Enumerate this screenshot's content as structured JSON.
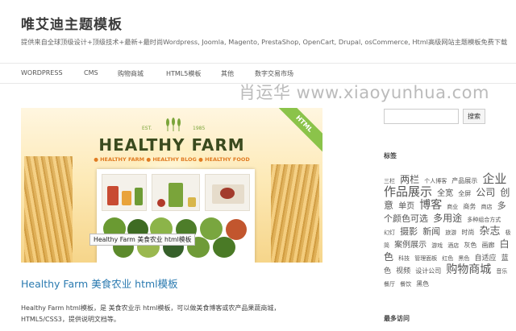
{
  "header": {
    "title": "唯艾迪主题模板",
    "description": "提供来自全球顶级设计+顶级技术+最新+最时尚Wordpress, Joomla, Magento, PrestaShop, OpenCart, Drupal, osCommerce, Html高级网站主题模板免费下载"
  },
  "nav": {
    "items": [
      {
        "label": "WORDPRESS"
      },
      {
        "label": "CMS"
      },
      {
        "label": "购物商城"
      },
      {
        "label": "HTML5模板"
      },
      {
        "label": "其他"
      },
      {
        "label": "数字交易市场"
      }
    ]
  },
  "watermark": "肖运华 www.xiaoyunhua.com",
  "post": {
    "image": {
      "est": "EST.",
      "year": "1985",
      "title": "HEALTHY FARM",
      "subtitle": "● HEALTHY FARM   ● HEALTHY BLOG   ● HEALTHY FOOD",
      "ribbon": "HTML",
      "tooltip": "Healthy Farm 美食农业 html模板"
    },
    "title": "Healthy Farm 美食农业 html模板",
    "excerpt_line1": "Healthy Farm html模板，是 美食农业示 html模板，可以做美食博客或农产品果蔬商城，",
    "excerpt_line2": "HTML5/CSS3，提供说明文档等。"
  },
  "sidebar": {
    "search": {
      "placeholder": "",
      "button_label": "搜索"
    },
    "tags_title": "标签",
    "tags": [
      {
        "text": "三栏",
        "size": 7
      },
      {
        "text": "两栏",
        "size": 12
      },
      {
        "text": "个人博客",
        "size": 7
      },
      {
        "text": "产品展示",
        "size": 8
      },
      {
        "text": "企业作品展示",
        "size": 15
      },
      {
        "text": "全宽",
        "size": 10
      },
      {
        "text": "全屏",
        "size": 8
      },
      {
        "text": "公司",
        "size": 12
      },
      {
        "text": "创意",
        "size": 12
      },
      {
        "text": "单页",
        "size": 10
      },
      {
        "text": "博客",
        "size": 14
      },
      {
        "text": "商业",
        "size": 7
      },
      {
        "text": "商务",
        "size": 8
      },
      {
        "text": "商店",
        "size": 7
      },
      {
        "text": "多个颜色可选",
        "size": 11
      },
      {
        "text": "多用途",
        "size": 12
      },
      {
        "text": "多种组合方式",
        "size": 7
      },
      {
        "text": "幻灯",
        "size": 7
      },
      {
        "text": "摄影",
        "size": 11
      },
      {
        "text": "新闻",
        "size": 11
      },
      {
        "text": "旅游",
        "size": 7
      },
      {
        "text": "时尚",
        "size": 8
      },
      {
        "text": "杂志",
        "size": 13
      },
      {
        "text": "极简",
        "size": 7
      },
      {
        "text": "案例展示",
        "size": 10
      },
      {
        "text": "游戏",
        "size": 7
      },
      {
        "text": "酒店",
        "size": 7
      },
      {
        "text": "灰色",
        "size": 8
      },
      {
        "text": "画廊",
        "size": 8
      },
      {
        "text": "白色",
        "size": 12
      },
      {
        "text": "科技",
        "size": 7
      },
      {
        "text": "管理面板",
        "size": 7
      },
      {
        "text": "红色",
        "size": 7
      },
      {
        "text": "黑色",
        "size": 7
      },
      {
        "text": "自适应",
        "size": 9
      },
      {
        "text": "蓝色",
        "size": 9
      },
      {
        "text": "视频",
        "size": 9
      },
      {
        "text": "设计公司",
        "size": 8
      },
      {
        "text": "购物商城",
        "size": 14
      },
      {
        "text": "音乐",
        "size": 7
      },
      {
        "text": "餐厅",
        "size": 7
      },
      {
        "text": "餐饮",
        "size": 7
      },
      {
        "text": "黑色",
        "size": 8
      }
    ],
    "popular_title": "最多访问"
  },
  "colors": {
    "link": "#2a7ab0",
    "accent_green": "#8bc34a",
    "food_orange": "#e07b22"
  }
}
